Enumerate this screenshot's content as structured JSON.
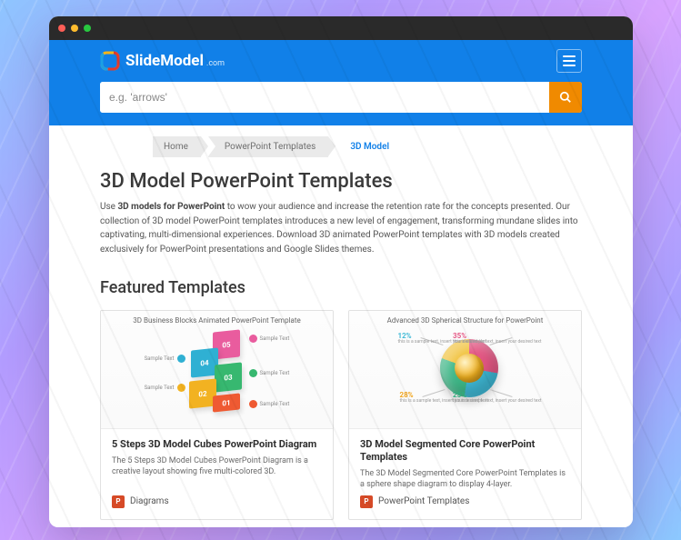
{
  "logo": {
    "brand": "SlideModel",
    "suffix": ".com"
  },
  "search": {
    "placeholder": "e.g. 'arrows'"
  },
  "breadcrumb": {
    "items": [
      "Home",
      "PowerPoint Templates"
    ],
    "current": "3D Model"
  },
  "page": {
    "title": "3D Model PowerPoint Templates",
    "intro_lead": "Use ",
    "intro_bold": "3D models for PowerPoint",
    "intro_rest": " to wow your audience and increase the retention rate for the concepts presented. Our collection of 3D model PowerPoint templates introduces a new level of engagement, transforming mundane slides into captivating, multi-dimensional experiences. Download 3D animated PowerPoint templates with 3D models created exclusively for PowerPoint presentations and Google Slides themes."
  },
  "featured": {
    "heading": "Featured Templates",
    "cards": [
      {
        "thumb_header": "3D Business Blocks Animated PowerPoint Template",
        "cube_labels": [
          "05",
          "04",
          "03",
          "02",
          "01"
        ],
        "bullet_text": "Sample Text",
        "title": "5 Steps 3D Model Cubes PowerPoint Diagram",
        "desc": "The 5 Steps 3D Model Cubes PowerPoint Diagram is a creative layout showing five multi-colored 3D.",
        "category": "Diagrams"
      },
      {
        "thumb_header": "Advanced 3D Spherical Structure for PowerPoint",
        "pcts": [
          "12%",
          "35%",
          "28%",
          "25%"
        ],
        "pct_sub": "this is a sample text, insert your desired text",
        "title": "3D Model Segmented Core PowerPoint Templates",
        "desc": "The 3D Model Segmented Core PowerPoint Templates is a sphere shape diagram to display 4-layer.",
        "category": "PowerPoint Templates"
      }
    ]
  }
}
